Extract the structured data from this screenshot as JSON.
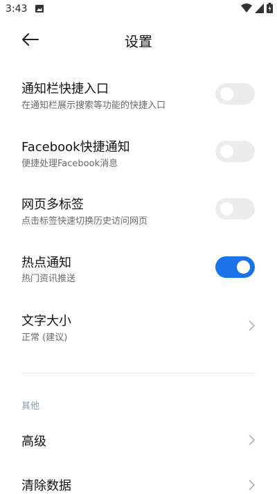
{
  "status": {
    "time": "3:43"
  },
  "header": {
    "title": "设置"
  },
  "settings": [
    {
      "title": "通知栏快捷入口",
      "subtitle": "在通知栏展示搜索等功能的快捷入口",
      "enabled": false
    },
    {
      "title": "Facebook快捷通知",
      "subtitle": "便捷处理Facebook消息",
      "enabled": false
    },
    {
      "title": "网页多标签",
      "subtitle": "点击标签快速切换历史访问网页",
      "enabled": false
    },
    {
      "title": "热点通知",
      "subtitle": "热门资讯推送",
      "enabled": true
    }
  ],
  "font_size": {
    "title": "文字大小",
    "value": "正常 (建议)"
  },
  "other": {
    "label": "其他",
    "items": [
      {
        "title": "高级"
      },
      {
        "title": "清除数据"
      }
    ]
  },
  "colors": {
    "accent": "#1a73e8",
    "toggle_off": "#ececec",
    "section_label": "#8e9bb0"
  }
}
